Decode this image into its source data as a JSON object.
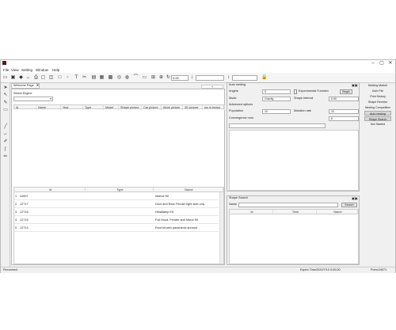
{
  "menu": [
    "File",
    "View",
    "Setting",
    "Window",
    "Help"
  ],
  "window_controls": [
    "–",
    "▢",
    "✕"
  ],
  "toolbar": {
    "field1": "0.00",
    "field2": ""
  },
  "left": {
    "tab_label": "Welcome Page",
    "select_engine_label": "Select Engine",
    "columns": [
      "Id",
      "Name",
      "Year",
      "Type",
      "Model",
      "Shape picture",
      "Car picture",
      "Work picture",
      "3D picture",
      "ew in brows"
    ],
    "bottom_columns": [
      "Id",
      "Type",
      "Name"
    ],
    "rows": [
      {
        "n": "1",
        "id": "12697",
        "type": "",
        "name": "Interior Kit"
      },
      {
        "n": "2",
        "id": "12717",
        "type": "",
        "name": "Door and Rear Fender right side only"
      },
      {
        "n": "3",
        "id": "12716",
        "type": "",
        "name": "Headlamp Kit"
      },
      {
        "n": "4",
        "id": "12715",
        "type": "",
        "name": "Full Hood, Fender and Mirror Kit"
      },
      {
        "n": "5",
        "id": "12714",
        "type": "",
        "name": "Roof kit  with panoramic sunroof"
      }
    ]
  },
  "auto_nesting": {
    "title": "Auto nesting",
    "angle_label": "Angele",
    "angle_value": "0",
    "experimental_label": "Experimental Function",
    "begin_label": "Begin",
    "mode_label": "Mode",
    "mode_value": "Gravity",
    "shape_interval_label": "Shape interval",
    "shape_interval_value": "0.50",
    "advanced_label": "Advanced options",
    "population_label": "Population",
    "population_value": "10",
    "mutation_label": "Mutation rate",
    "mutation_value": "10",
    "convergence_label": "Convergence num",
    "convergence_value": "6"
  },
  "shape_search": {
    "title": "Shape Search",
    "name_label": "Name",
    "search_label": "Search",
    "columns": [
      "id",
      "Time",
      "Name"
    ]
  },
  "right_panel": {
    "items": [
      "Nesting Market",
      "User File",
      "Print History",
      "Shape Receive",
      "Nesting Competition",
      "Auto nesting",
      "Shape Search",
      "Not Started"
    ]
  },
  "status": {
    "left": "Reconnect",
    "expire": "Expire Time2020/7/10 0:00:00",
    "point": "Point:24071"
  }
}
